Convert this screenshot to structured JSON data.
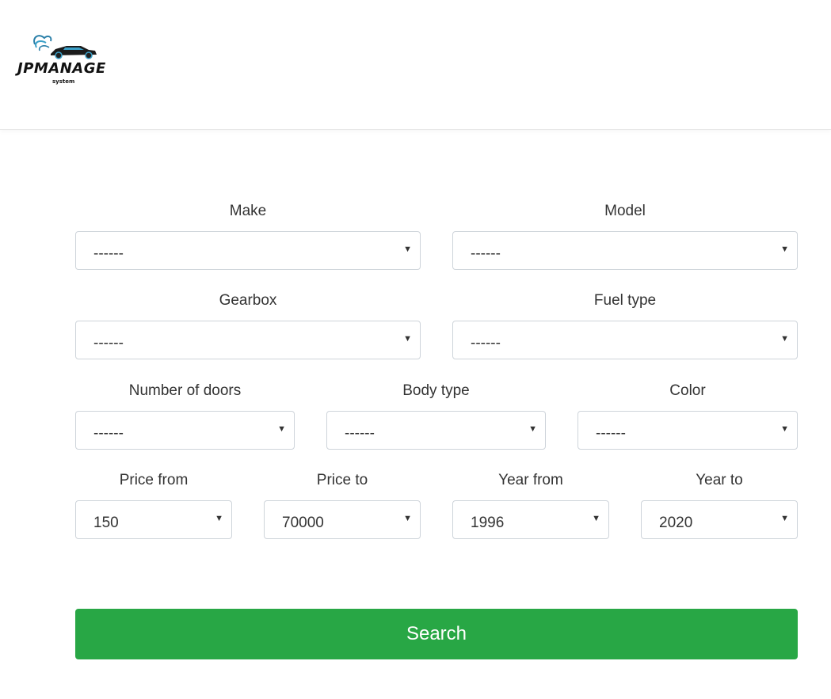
{
  "brand": {
    "title": "JPMANAGE",
    "subtitle": "system"
  },
  "form": {
    "make": {
      "label": "Make",
      "value": "------"
    },
    "model": {
      "label": "Model",
      "value": "------"
    },
    "gearbox": {
      "label": "Gearbox",
      "value": "------"
    },
    "fuel_type": {
      "label": "Fuel type",
      "value": "------"
    },
    "doors": {
      "label": "Number of doors",
      "value": "------"
    },
    "body_type": {
      "label": "Body type",
      "value": "------"
    },
    "color": {
      "label": "Color",
      "value": "------"
    },
    "price_from": {
      "label": "Price from",
      "value": "150"
    },
    "price_to": {
      "label": "Price to",
      "value": "70000"
    },
    "year_from": {
      "label": "Year from",
      "value": "1996"
    },
    "year_to": {
      "label": "Year to",
      "value": "2020"
    },
    "search_label": "Search"
  },
  "colors": {
    "accent": "#28a745",
    "border": "#ced4da"
  }
}
